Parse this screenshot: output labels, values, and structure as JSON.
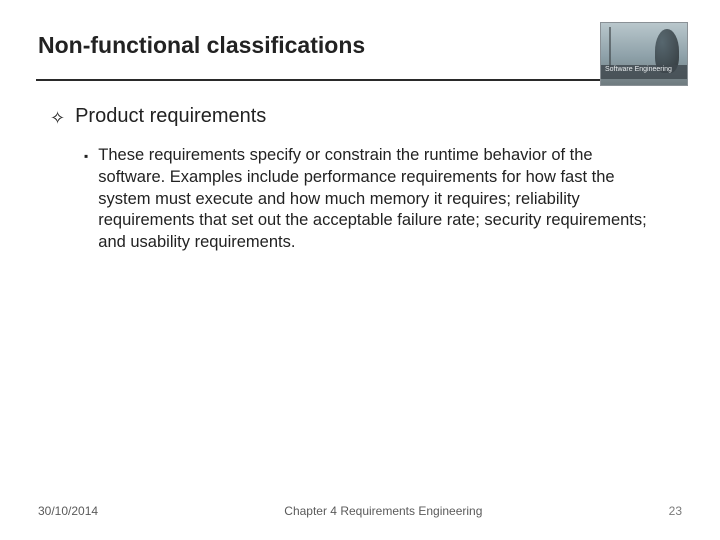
{
  "slide": {
    "title": "Non-functional classifications",
    "logo_text": "Software Engineering",
    "section_heading": "Product requirements",
    "body": "These requirements specify or constrain the runtime behavior of the software. Examples include performance requirements for how fast the system must execute and how much memory it requires; reliability requirements that set out the acceptable failure rate; security requirements; and usability requirements."
  },
  "footer": {
    "date": "30/10/2014",
    "chapter": "Chapter 4 Requirements Engineering",
    "page": "23"
  }
}
